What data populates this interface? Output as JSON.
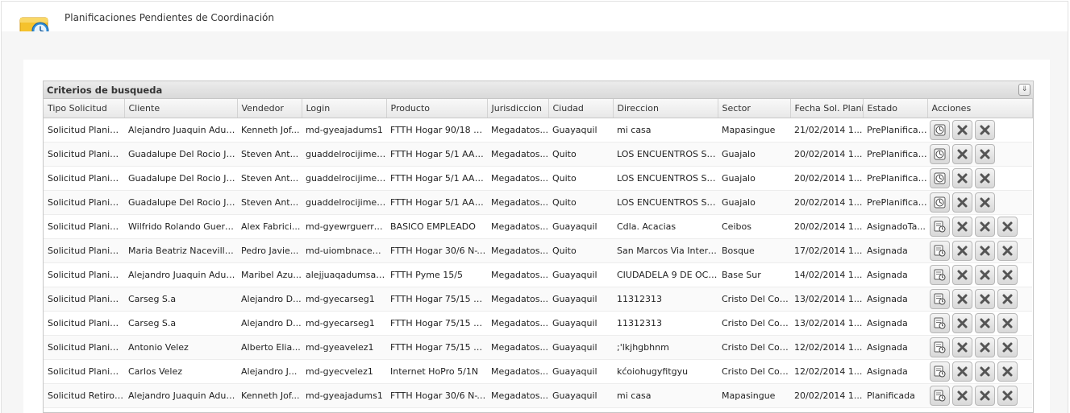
{
  "page": {
    "title": "Planificaciones Pendientes de Coordinación"
  },
  "panel": {
    "title": "Criterios de busqueda"
  },
  "columns": [
    "Tipo Solicitud",
    "Cliente",
    "Vendedor",
    "Login",
    "Producto",
    "Jurisdiccion",
    "Ciudad",
    "Direccion",
    "Sector",
    "Fecha Sol. Planific",
    "Estado",
    "Acciones"
  ],
  "rows": [
    [
      "Solicitud Planific...",
      "Alejandro Juaquin Adum...",
      "Kenneth Jof...",
      "md-gyeajadums1",
      "FTTH Hogar 90/18 N-...",
      "Megadatos...",
      "Guayaquil",
      "mi casa",
      "Mapasingue",
      "21/02/2014 1...",
      "PrePlanificada"
    ],
    [
      "Solicitud Planific...",
      "Guadalupe Del Rocio Jim...",
      "Steven Ant...",
      "guaddelrocijimefer",
      "FTTH Hogar 5/1 AAA.P",
      "Megadatos...",
      "Quito",
      "LOS ENCUENTROS S1...",
      "Guajalo",
      "20/02/2014 1...",
      "PrePlanificada"
    ],
    [
      "Solicitud Planific...",
      "Guadalupe Del Rocio Jim...",
      "Steven Ant...",
      "guaddelrocijimefer",
      "FTTH Hogar 5/1 AAA.P",
      "Megadatos...",
      "Quito",
      "LOS ENCUENTROS S1...",
      "Guajalo",
      "20/02/2014 1...",
      "PrePlanificada"
    ],
    [
      "Solicitud Planific...",
      "Guadalupe Del Rocio Jim...",
      "Steven Ant...",
      "guaddelrocijimefer",
      "FTTH Hogar 5/1 AAA.P",
      "Megadatos...",
      "Quito",
      "LOS ENCUENTROS S1...",
      "Guajalo",
      "20/02/2014 1...",
      "PrePlanificada"
    ],
    [
      "Solicitud Planific...",
      "Wilfrido Rolando Guerrer...",
      "Alex Fabrici...",
      "md-gyewrguerre...",
      "BASICO EMPLEADO",
      "Megadatos...",
      "Guayaquil",
      "Cdla. Acacias",
      "Ceibos",
      "20/02/2014 1...",
      "AsignadoTa..."
    ],
    [
      "Solicitud Planific...",
      "Maria Beatriz Nacevilla A...",
      "Pedro Javie...",
      "md-uiombnacevill...",
      "FTTH Hogar 30/6 N-T...",
      "Megadatos...",
      "Quito",
      "San Marcos Via Intero...",
      "Bosque",
      "17/02/2014 1...",
      "Asignada"
    ],
    [
      "Solicitud Planific...",
      "Alejandro Juaquin Adum...",
      "Maribel Azu...",
      "alejjuaqadumsalc...",
      "FTTH Pyme 15/5",
      "Megadatos...",
      "Guayaquil",
      "CIUDADELA 9 DE OCT...",
      "Base Sur",
      "14/02/2014 1...",
      "Asignada"
    ],
    [
      "Solicitud Planific...",
      "Carseg S.a",
      "Alejandro D...",
      "md-gyecarseg1",
      "FTTH Hogar 75/15 N-...",
      "Megadatos...",
      "Guayaquil",
      "11312313",
      "Cristo Del Con...",
      "13/02/2014 1...",
      "Asignada"
    ],
    [
      "Solicitud Planific...",
      "Carseg S.a",
      "Alejandro D...",
      "md-gyecarseg1",
      "FTTH Hogar 75/15 N-...",
      "Megadatos...",
      "Guayaquil",
      "11312313",
      "Cristo Del Con...",
      "13/02/2014 1...",
      "Asignada"
    ],
    [
      "Solicitud Planific...",
      "Antonio Velez",
      "Alberto Elia...",
      "md-gyeavelez1",
      "FTTH Hogar 75/15 N-...",
      "Megadatos...",
      "Guayaquil",
      ";'lkjhgbhnm",
      "Cristo Del Con...",
      "12/02/2014 1...",
      "Asignada"
    ],
    [
      "Solicitud Planific...",
      "Carlos Velez",
      "Alejandro J...",
      "md-gyecvelez1",
      "Internet HoPro 5/1N",
      "Megadatos...",
      "Guayaquil",
      "kćoiohugyfitgyu",
      "Cristo Del Con...",
      "12/02/2014 1...",
      "Asignada"
    ],
    [
      "Solicitud Retiro ...",
      "Alejandro Juaquin Adum...",
      "Kenneth Jof...",
      "md-gyeajadums1",
      "FTTH Hogar 30/6 N-T...",
      "Megadatos...",
      "Guayaquil",
      "mi casa",
      "Mapasingue",
      "20/02/2014 1...",
      "Planificada"
    ]
  ],
  "row_actions": [
    [
      "clock-icon",
      "delete-icon",
      "delete-icon"
    ],
    [
      "clock-icon",
      "delete-icon",
      "delete-icon"
    ],
    [
      "clock-icon",
      "delete-icon",
      "delete-icon"
    ],
    [
      "clock-icon",
      "delete-icon",
      "delete-icon"
    ],
    [
      "assign-icon",
      "delete-icon",
      "delete-icon",
      "delete-icon"
    ],
    [
      "assign-icon",
      "delete-icon",
      "delete-icon",
      "delete-icon"
    ],
    [
      "assign-icon",
      "delete-icon",
      "delete-icon",
      "delete-icon"
    ],
    [
      "assign-icon",
      "delete-icon",
      "delete-icon",
      "delete-icon"
    ],
    [
      "assign-icon",
      "delete-icon",
      "delete-icon",
      "delete-icon"
    ],
    [
      "assign-icon",
      "delete-icon",
      "delete-icon",
      "delete-icon"
    ],
    [
      "assign-icon",
      "delete-icon",
      "delete-icon",
      "delete-icon"
    ],
    [
      "assign-icon",
      "delete-icon",
      "delete-icon",
      "delete-icon"
    ]
  ],
  "colors": {
    "header_bg": "#e8e8e8",
    "border": "#c6c6c6",
    "icon_blue": "#2f8fd8",
    "icon_yellow": "#f5c22c"
  }
}
